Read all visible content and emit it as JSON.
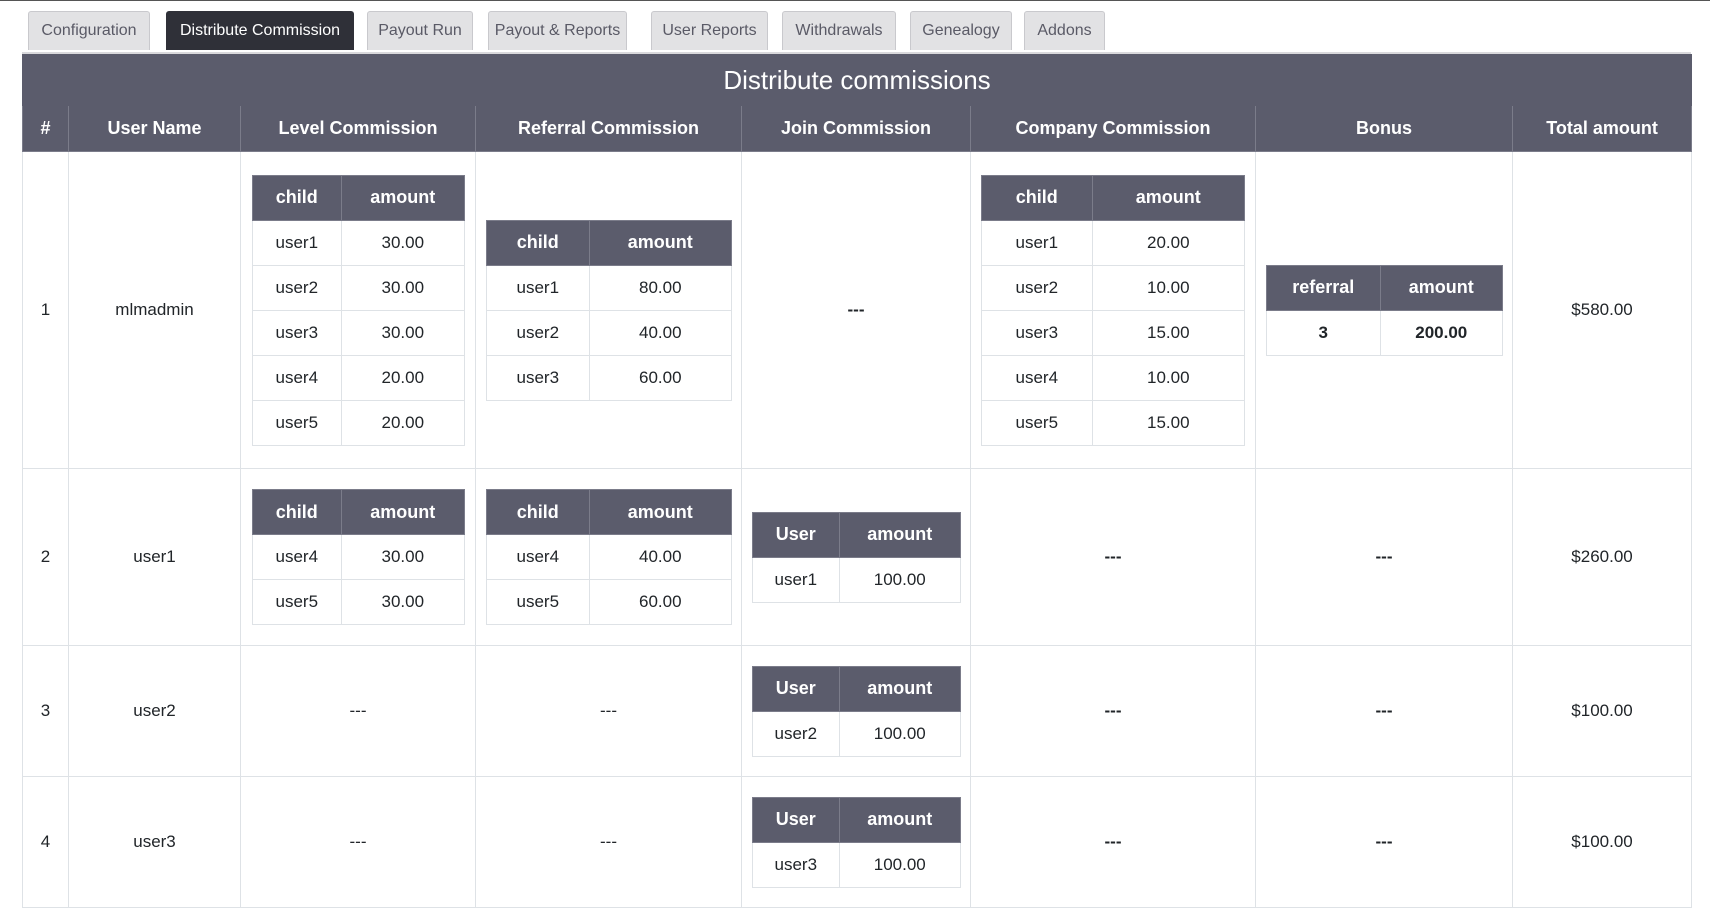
{
  "tabs": [
    {
      "label": "Configuration",
      "active": false
    },
    {
      "label": "Distribute Commission",
      "active": true
    },
    {
      "label": "Payout Run",
      "active": false
    },
    {
      "label": "Payout & Reports",
      "active": false
    },
    {
      "label": "User Reports",
      "active": false
    },
    {
      "label": "Withdrawals",
      "active": false
    },
    {
      "label": "Genealogy",
      "active": false
    },
    {
      "label": "Addons",
      "active": false
    }
  ],
  "table": {
    "title": "Distribute commissions",
    "headers": [
      "#",
      "User Name",
      "Level Commission",
      "Referral Commission",
      "Join Commission",
      "Company Commission",
      "Bonus",
      "Total amount"
    ],
    "empty": "---",
    "sub_headers": {
      "child": "child",
      "amount": "amount",
      "user": "User",
      "referral": "referral"
    },
    "rows": [
      {
        "num": "1",
        "user": "mlmadmin",
        "level": [
          [
            "user1",
            "30.00"
          ],
          [
            "user2",
            "30.00"
          ],
          [
            "user3",
            "30.00"
          ],
          [
            "user4",
            "20.00"
          ],
          [
            "user5",
            "20.00"
          ]
        ],
        "referral": [
          [
            "user1",
            "80.00"
          ],
          [
            "user2",
            "40.00"
          ],
          [
            "user3",
            "60.00"
          ]
        ],
        "join": null,
        "company": [
          [
            "user1",
            "20.00"
          ],
          [
            "user2",
            "10.00"
          ],
          [
            "user3",
            "15.00"
          ],
          [
            "user4",
            "10.00"
          ],
          [
            "user5",
            "15.00"
          ]
        ],
        "bonus": [
          [
            "3",
            "200.00"
          ]
        ],
        "total": "$580.00"
      },
      {
        "num": "2",
        "user": "user1",
        "level": [
          [
            "user4",
            "30.00"
          ],
          [
            "user5",
            "30.00"
          ]
        ],
        "referral": [
          [
            "user4",
            "40.00"
          ],
          [
            "user5",
            "60.00"
          ]
        ],
        "join": [
          [
            "user1",
            "100.00"
          ]
        ],
        "company": null,
        "bonus": null,
        "total": "$260.00"
      },
      {
        "num": "3",
        "user": "user2",
        "level": null,
        "referral": null,
        "join": [
          [
            "user2",
            "100.00"
          ]
        ],
        "company": null,
        "bonus": null,
        "total": "$100.00"
      },
      {
        "num": "4",
        "user": "user3",
        "level": null,
        "referral": null,
        "join": [
          [
            "user3",
            "100.00"
          ]
        ],
        "company": null,
        "bonus": null,
        "total": "$100.00"
      }
    ]
  },
  "colors": {
    "header_bg": "#5b5c6c",
    "active_tab_bg": "#2f3038",
    "tab_bg": "#e2e2e4"
  }
}
